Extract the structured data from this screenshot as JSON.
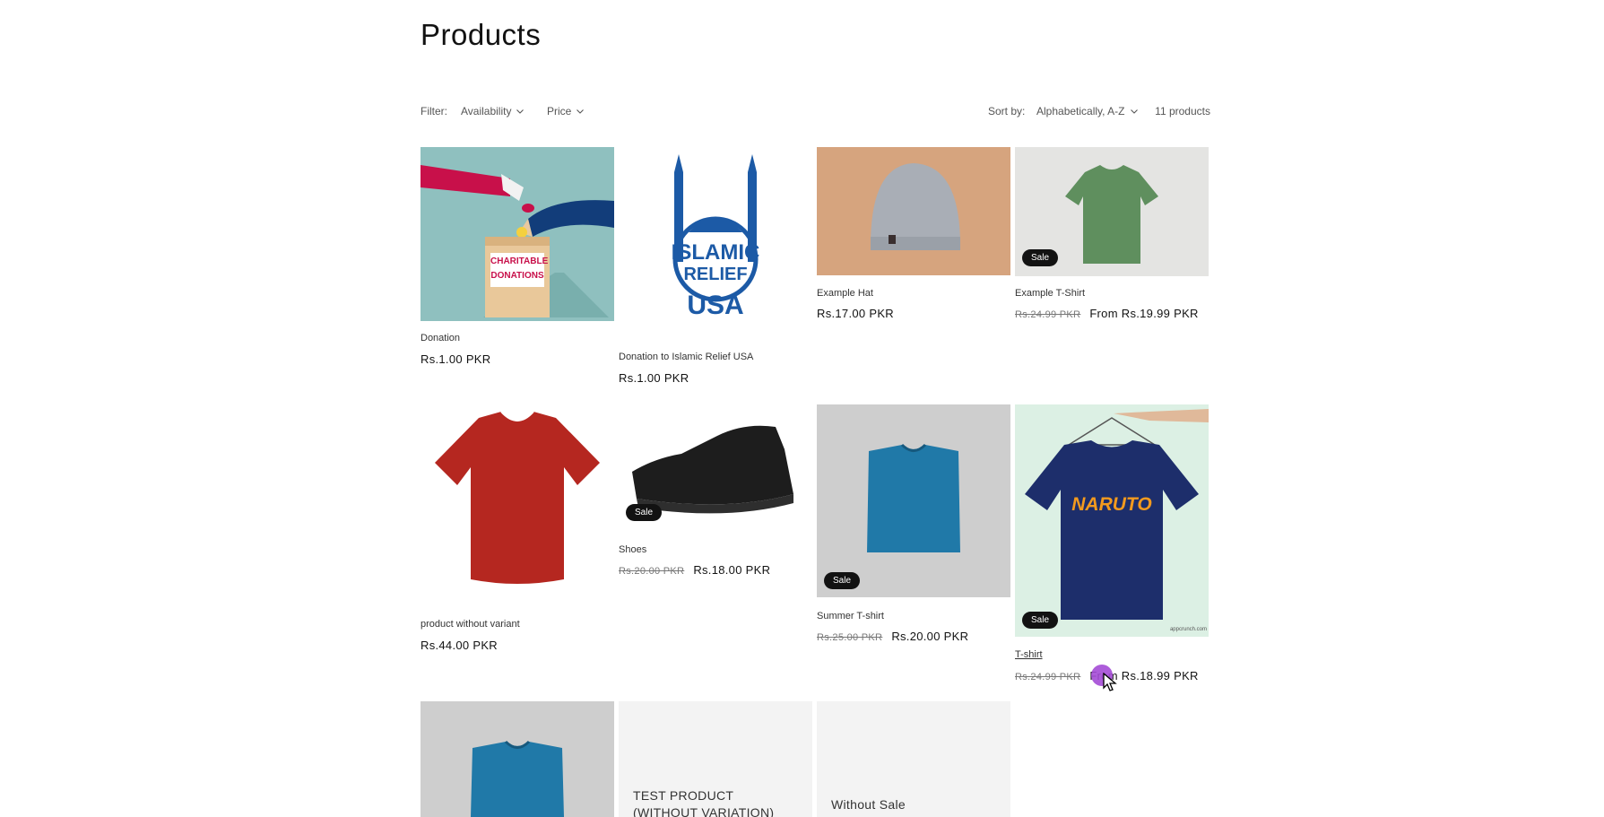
{
  "page": {
    "title": "Products"
  },
  "filters": {
    "label": "Filter:",
    "availability": "Availability",
    "price": "Price",
    "sort_label": "Sort by:",
    "sort_value": "Alphabetically, A-Z",
    "count": "11 products"
  },
  "products": [
    {
      "name": "Donation",
      "price": "Rs.1.00 PKR",
      "image": "charitable-donations-illustration"
    },
    {
      "name": "Donation to Islamic Relief USA",
      "price": "Rs.1.00 PKR",
      "image": "islamic-relief-usa-logo"
    },
    {
      "name": "Example Hat",
      "price": "Rs.17.00 PKR",
      "image": "grey-beanie-hat"
    },
    {
      "name": "Example T-Shirt",
      "old_price": "Rs.24.99 PKR",
      "price": "From Rs.19.99 PKR",
      "badge": "Sale",
      "image": "green-tshirt"
    },
    {
      "name": "product without variant",
      "price": "Rs.44.00 PKR",
      "image": "red-tshirt"
    },
    {
      "name": "Shoes",
      "old_price": "Rs.20.00 PKR",
      "price": "Rs.18.00 PKR",
      "badge": "Sale",
      "image": "black-sneaker"
    },
    {
      "name": "Summer T-shirt",
      "old_price": "Rs.25.00 PKR",
      "price": "Rs.20.00 PKR",
      "badge": "Sale",
      "image": "folded-blue-tshirt"
    },
    {
      "name": "T-shirt",
      "old_price": "Rs.24.99 PKR",
      "price": "From Rs.18.99 PKR",
      "badge": "Sale",
      "image": "navy-naruto-tshirt",
      "logo_text": "NARUTO",
      "watermark": "appcrunch.com"
    },
    {
      "name": "",
      "image": "folded-blue-tshirt"
    },
    {
      "name": "TEST PRODUCT (WITHOUT VARIATION)",
      "image": "placeholder"
    },
    {
      "name": "Without Sale",
      "image": "placeholder"
    }
  ],
  "image_text": {
    "donation_box": [
      "CHARITABLE",
      "DONATIONS"
    ],
    "relief_logo": [
      "ISLAMIC",
      "RELIEF",
      "USA"
    ]
  },
  "colors": {
    "badge_bg": "#121212",
    "cursor": "#a44bd6"
  }
}
